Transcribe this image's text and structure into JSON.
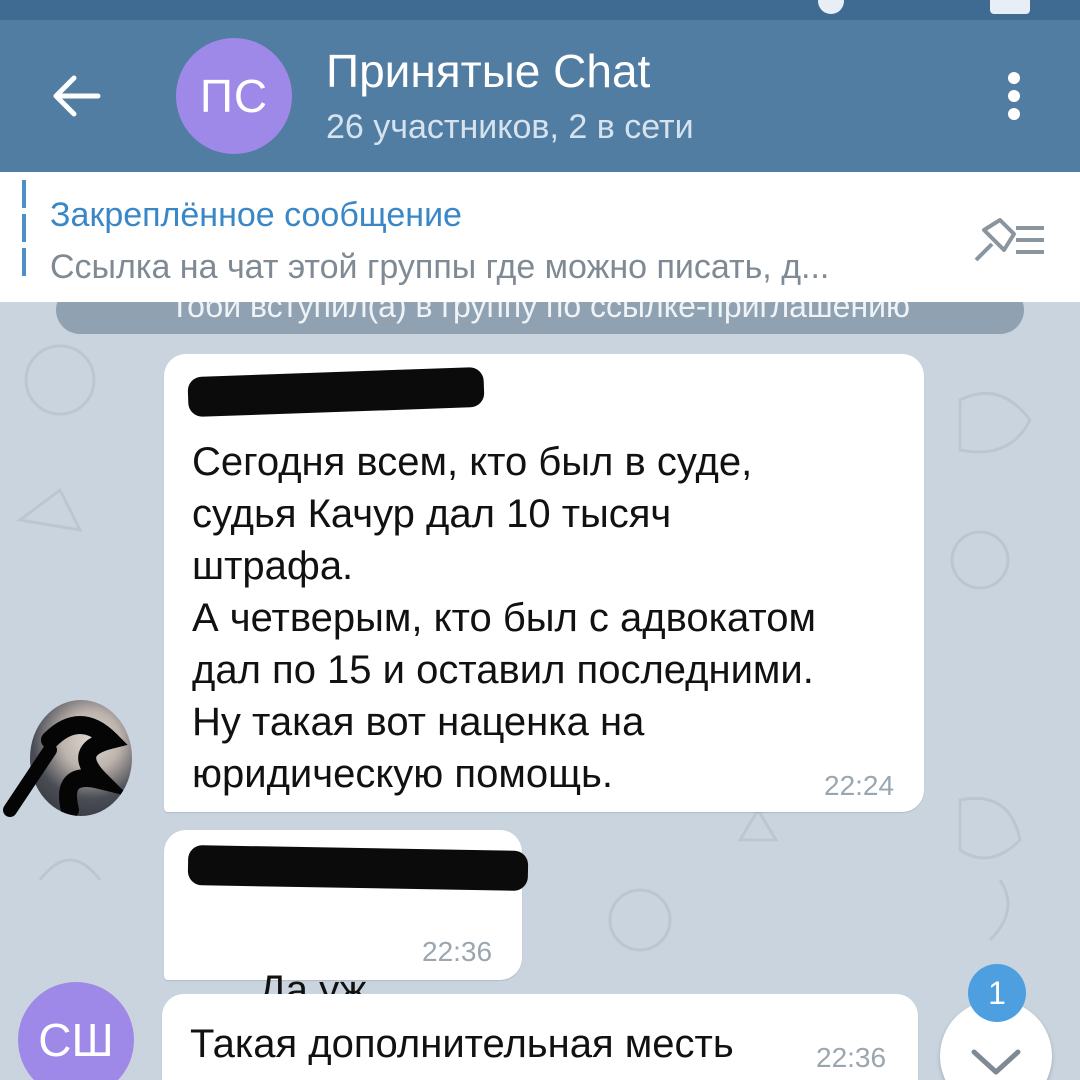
{
  "header": {
    "avatar_initials": "ПС",
    "title": "Принятые Chat",
    "subtitle": "26 участников, 2 в сети"
  },
  "pinned": {
    "title": "Закреплённое сообщение",
    "text": "Ссылка на чат этой группы где можно писать, д..."
  },
  "service_message": "Тоби вступил(а) в группу по ссылке-приглашению",
  "messages": [
    {
      "text": "Сегодня всем, кто был в суде,\nсудья Качур дал 10 тысяч\nштрафа.\nА четверым, кто был с адвокатом\nдал по 15 и оставил последними.\nНу такая вот наценка на\nюридическую помощь.",
      "time": "22:24"
    },
    {
      "text": "Да уж..",
      "time": "22:36"
    },
    {
      "text": "Такая дополнительная месть",
      "time": "22:36",
      "avatar_initials": "СШ"
    }
  ],
  "scroll_down": {
    "unread_count": "1"
  },
  "colors": {
    "header": "#517da2",
    "accent": "#3a87c7",
    "avatar": "#9e88e8",
    "chat_bg": "#c9d4de",
    "badge": "#4d9fe0"
  }
}
